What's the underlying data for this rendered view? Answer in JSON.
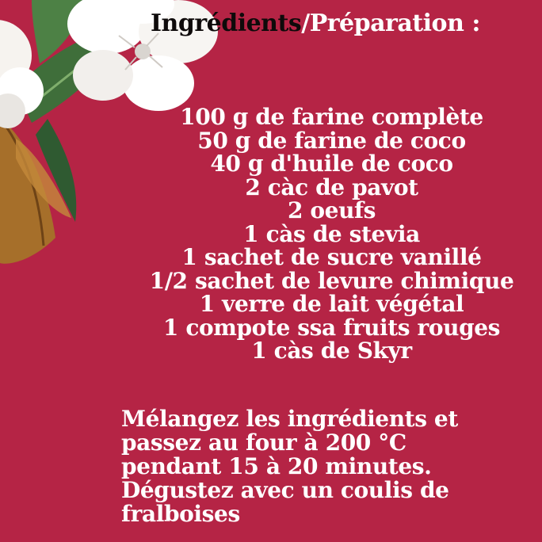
{
  "title": {
    "part1": "Ingrédients",
    "part2": "/Préparation :"
  },
  "ingredients": [
    "100 g de farine complète",
    "50 g de farine de coco",
    "40 g d'huile de coco",
    "2 càc de pavot",
    "2 oeufs",
    "1 càs de stevia",
    "1 sachet de sucre vanillé",
    "1/2 sachet de levure chimique",
    "1 verre de lait végétal",
    "1 compote ssa fruits rouges",
    "1 càs de Skyr"
  ],
  "method": [
    "Mélangez les ingrédients et",
    "passez au four à 200 °C",
    "pendant 15 à 20 minutes.",
    "Dégustez avec un coulis de",
    "fralboises"
  ],
  "colors": {
    "background": "#b52445",
    "title_dark": "#0e0a0a",
    "text": "#ffffff"
  },
  "decoration": [
    "white-flower-icon",
    "green-leaf-icon",
    "brown-leaf-icon"
  ]
}
